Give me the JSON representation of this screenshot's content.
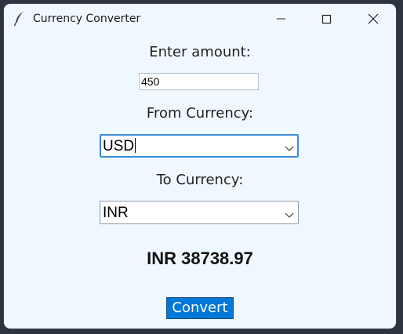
{
  "window": {
    "title": "Currency Converter",
    "background": "#f0f8ff"
  },
  "form": {
    "amount_label": "Enter amount:",
    "amount_value": "450",
    "from_label": "From Currency:",
    "from_value": "USD",
    "to_label": "To Currency:",
    "to_value": "INR",
    "result_text": "INR 38738.97",
    "convert_label": "Convert"
  },
  "icons": {
    "app": "feather-icon",
    "minimize": "minimize-icon",
    "maximize": "maximize-icon",
    "close": "close-icon",
    "dropdown": "chevron-down-icon"
  },
  "colors": {
    "accent": "#0078d7",
    "focus": "#3b8bd8"
  }
}
